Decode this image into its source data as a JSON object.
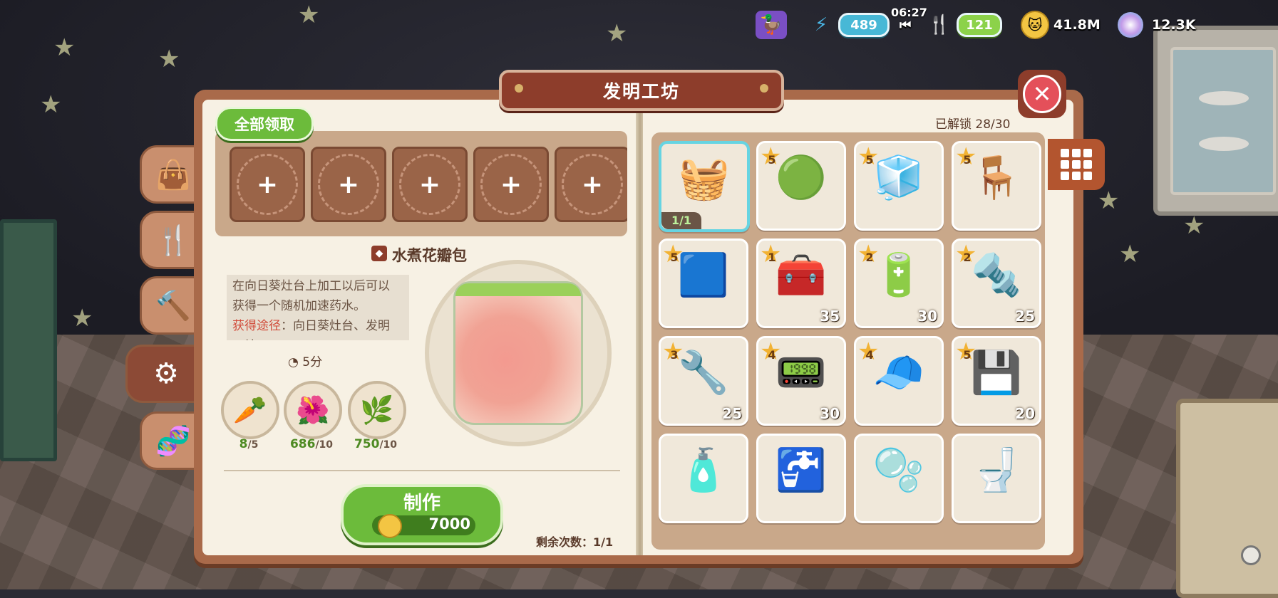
{
  "hud": {
    "energy": "489",
    "timer": "06:27",
    "food": "121",
    "coins": "41.8M",
    "gems": "12.3K"
  },
  "window": {
    "title": "发明工坊",
    "close_icon": "close-icon"
  },
  "left_page": {
    "claim_all": "全部领取",
    "slots": [
      "+",
      "+",
      "+",
      "+",
      "+"
    ],
    "item_name": "水煮花瓣包",
    "desc_line1": "在向日葵灶台上加工以后可以",
    "desc_line2": "获得一个随机加速药水。",
    "source_label": "获得途径",
    "source_text": "：向日葵灶台、发明",
    "source_more": "工坊",
    "craft_time": "5分",
    "ingredients": [
      {
        "icon": "ginseng-icon",
        "have": "8",
        "need": "/5"
      },
      {
        "icon": "red-petals-icon",
        "have": "686",
        "need": "/10"
      },
      {
        "icon": "vine-wreath-icon",
        "have": "750",
        "need": "/10"
      }
    ],
    "make_label": "制作",
    "cost": "7000",
    "remaining": "剩余次数：1/1"
  },
  "right_page": {
    "unlocked": "已解锁  28/30",
    "items": [
      {
        "name": "petal-bag",
        "icon": "🧺",
        "stars": "",
        "count": "",
        "owned": "1/1",
        "selected": true
      },
      {
        "name": "green-slime",
        "icon": "🟢",
        "stars": "5",
        "count": ""
      },
      {
        "name": "glass-tank",
        "icon": "🧊",
        "stars": "5",
        "count": ""
      },
      {
        "name": "wooden-stand",
        "icon": "🪑",
        "stars": "5",
        "count": ""
      },
      {
        "name": "blue-cloth",
        "icon": "🟦",
        "stars": "5",
        "count": ""
      },
      {
        "name": "copper-coil",
        "icon": "🧰",
        "stars": "1",
        "count": "35"
      },
      {
        "name": "capacitor",
        "icon": "🔋",
        "stars": "2",
        "count": "30"
      },
      {
        "name": "metal-pipe",
        "icon": "🔩",
        "stars": "2",
        "count": "25"
      },
      {
        "name": "motor-part",
        "icon": "🔧",
        "stars": "3",
        "count": "25"
      },
      {
        "name": "circuit-board",
        "icon": "📟",
        "stars": "4",
        "count": "30"
      },
      {
        "name": "propeller-hat",
        "icon": "🧢",
        "stars": "4",
        "count": ""
      },
      {
        "name": "green-chip",
        "icon": "💾",
        "stars": "5",
        "count": "20"
      },
      {
        "name": "bath-shelf",
        "icon": "🧴",
        "stars": "",
        "count": ""
      },
      {
        "name": "sink-cabinet",
        "icon": "🚰",
        "stars": "",
        "count": ""
      },
      {
        "name": "washing-machine",
        "icon": "🫧",
        "stars": "",
        "count": ""
      },
      {
        "name": "toilet",
        "icon": "🚽",
        "stars": "",
        "count": ""
      }
    ]
  },
  "side_tabs": [
    "bag-icon",
    "utensils-icon",
    "hammer-icon",
    "lightbulb-gear-icon",
    "dna-icon"
  ]
}
